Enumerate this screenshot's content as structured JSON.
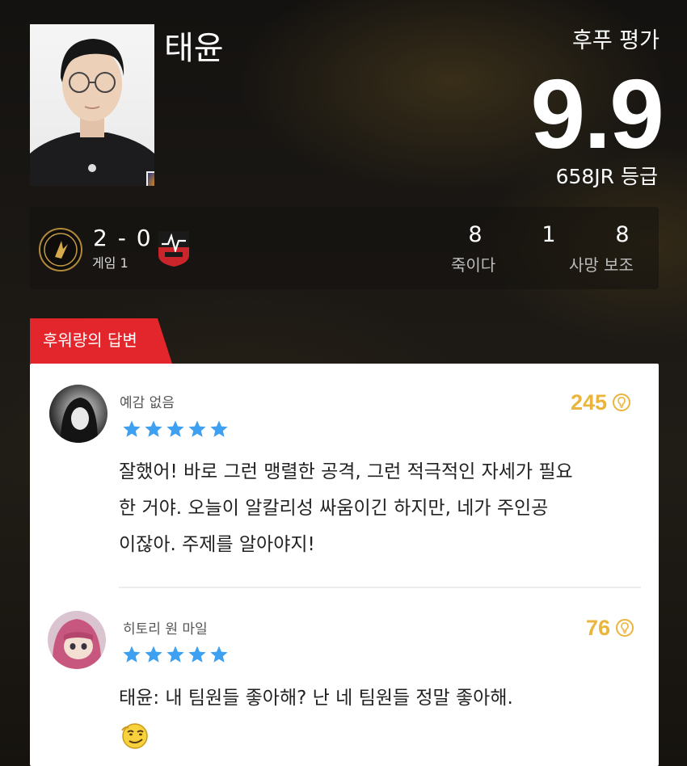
{
  "player": {
    "name": "태윤",
    "portrait_icon": "player-portrait",
    "champion_icon": "champion-icon"
  },
  "rating": {
    "label": "후푸 평가",
    "score": "9.9",
    "grade": "658JR 등급"
  },
  "match": {
    "team_a_icon": "team-logo-gold",
    "score": "2 - 0",
    "game": "게임 1",
    "team_b_icon": "team-logo-red",
    "stats": [
      {
        "value": "8",
        "label": "죽이다"
      },
      {
        "value": "1",
        "label": ""
      },
      {
        "value": "8",
        "label": "사망 보조"
      }
    ]
  },
  "reviews_section": {
    "title": "후워량의 답변",
    "reviews": [
      {
        "reviewer": "예감 없음",
        "stars": 5,
        "likes": "245",
        "lines": [
          "잘했어! 바로 그런 맹렬한 공격, 그런 적극적인 자세가 필요",
          "한 거야. 오늘이 알칼리성 싸움이긴 하지만, 네가 주인공",
          "이잖아. 주제를 알아야지!"
        ]
      },
      {
        "reviewer": "히토리 원 마일",
        "stars": 5,
        "likes": "76",
        "lines": [
          "태윤: 내 팀원들 좋아해? 난 네 팀원들 정말 좋아해."
        ],
        "emoji_icon": "smirk-emoji-icon"
      }
    ]
  },
  "colors": {
    "accent_red": "#e3262b",
    "likes_gold": "#e9b53c",
    "star_blue": "#3ea0f0"
  }
}
